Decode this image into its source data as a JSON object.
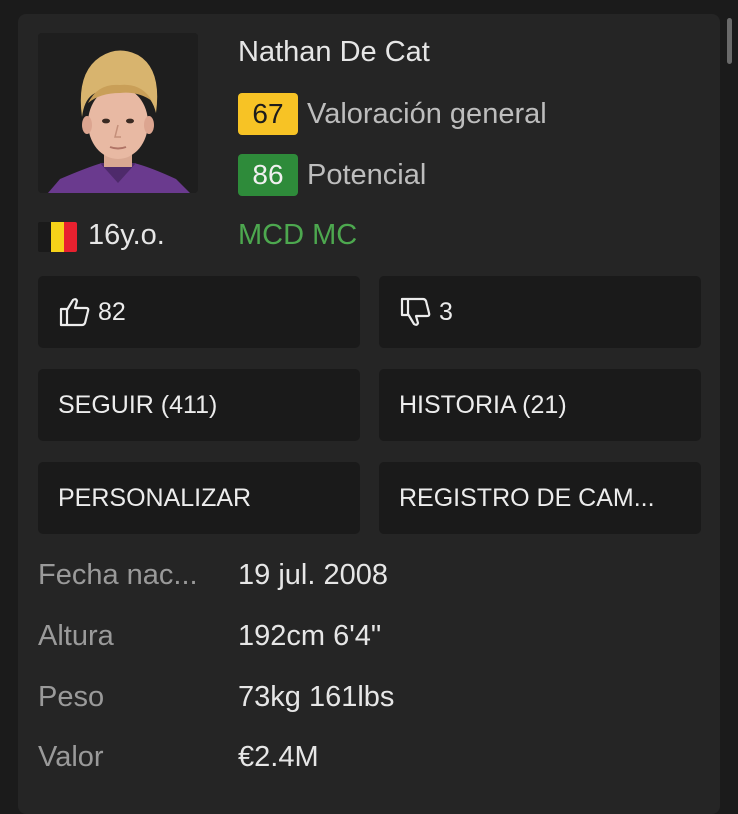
{
  "player": {
    "name": "Nathan De Cat",
    "overall_rating": "67",
    "overall_label": "Valoración general",
    "potential_rating": "86",
    "potential_label": "Potencial",
    "nationality_flag": "belgium-flag",
    "age": "16y.o.",
    "positions": "MCD MC"
  },
  "colors": {
    "overall_badge": "#f7c325",
    "potential_badge": "#2e8b3a",
    "positions_text": "#4da84f",
    "card_background": "#252525",
    "button_background": "#1a1a1a"
  },
  "votes": {
    "like_icon": "thumbs-up-icon",
    "like_count": "82",
    "dislike_icon": "thumbs-down-icon",
    "dislike_count": "3"
  },
  "actions": {
    "follow": "SEGUIR (411)",
    "history": "HISTORIA (21)",
    "customize": "PERSONALIZAR",
    "changelog": "REGISTRO DE CAM..."
  },
  "info": [
    {
      "label": "Fecha nac...",
      "value": "19 jul. 2008"
    },
    {
      "label": "Altura",
      "value": "192cm 6'4\""
    },
    {
      "label": "Peso",
      "value": "73kg 161lbs"
    },
    {
      "label": "Valor",
      "value": "€2.4M"
    }
  ]
}
